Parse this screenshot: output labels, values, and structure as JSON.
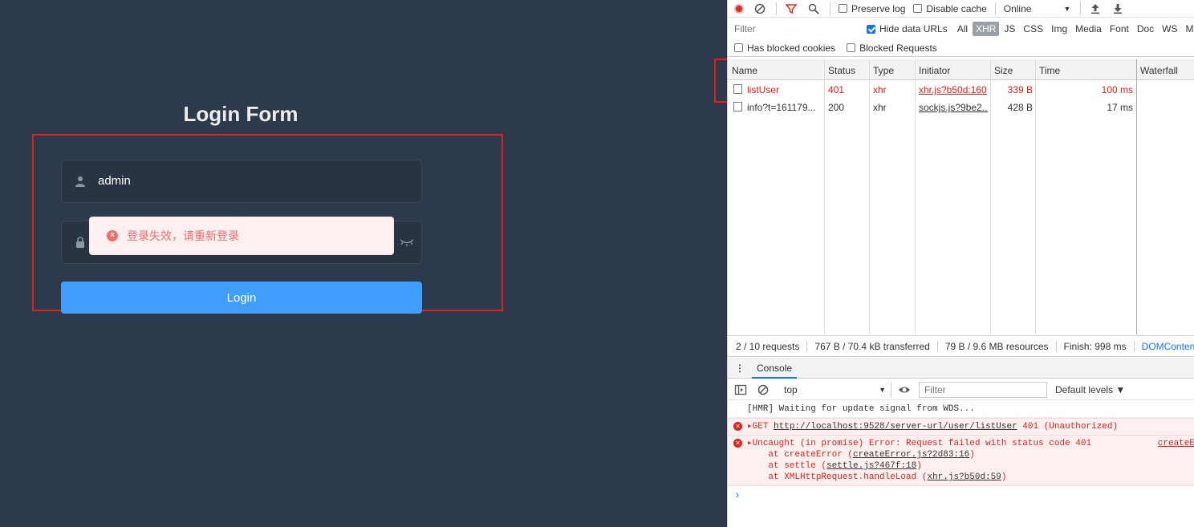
{
  "login": {
    "title": "Login Form",
    "username_value": "admin",
    "button_label": "Login",
    "toast_message": "登录失效，请重新登录",
    "error_color": "#f56c6c",
    "button_color": "#409eff",
    "bg_color": "#2d3a4b"
  },
  "devtools": {
    "toolbar": {
      "preserve_log": "Preserve log",
      "disable_cache": "Disable cache",
      "throttling": "Online"
    },
    "filter_bar": {
      "filter_placeholder": "Filter",
      "hide_data_urls": "Hide data URLs",
      "types": [
        "All",
        "XHR",
        "JS",
        "CSS",
        "Img",
        "Media",
        "Font",
        "Doc",
        "WS",
        "Ma"
      ],
      "active_type": "XHR",
      "has_blocked_cookies": "Has blocked cookies",
      "blocked_requests": "Blocked Requests"
    },
    "columns": [
      "Name",
      "Status",
      "Type",
      "Initiator",
      "Size",
      "Time",
      "Waterfall"
    ],
    "requests": [
      {
        "name": "listUser",
        "status": "401",
        "type": "xhr",
        "initiator": "xhr.js?b50d:160",
        "size": "339 B",
        "time": "100 ms",
        "error": true
      },
      {
        "name": "info?t=161179...",
        "status": "200",
        "type": "xhr",
        "initiator": "sockjs.js?9be2...",
        "size": "428 B",
        "time": "17 ms",
        "error": false
      }
    ],
    "status_bar": {
      "requests": "2 / 10 requests",
      "transferred": "767 B / 70.4 kB transferred",
      "resources": "79 B / 9.6 MB resources",
      "finish": "Finish: 998 ms",
      "domcontent": "DOMContentL"
    },
    "drawer": {
      "tab": "Console",
      "context": "top",
      "filter_placeholder": "Filter",
      "levels": "Default levels ▼"
    },
    "console": {
      "hmr": "[HMR] Waiting for update signal from WDS...",
      "get_prefix": "▸GET ",
      "get_url": "http://localhost:9528/server-url/user/listUser",
      "get_suffix": " 401 (Unauthorized)",
      "uncaught": "▸Uncaught (in promise) Error: Request failed with status code 401",
      "uncaught_link": "createE",
      "stack1_prefix": "    at createError (",
      "stack1_link": "createError.js?2d83:16",
      "stack2_prefix": "    at settle (",
      "stack2_link": "settle.js?467f:18",
      "stack3_prefix": "    at XMLHttpRequest.handleLoad (",
      "stack3_link": "xhr.js?b50d:59",
      "close_paren": ")",
      "prompt": "›"
    }
  }
}
